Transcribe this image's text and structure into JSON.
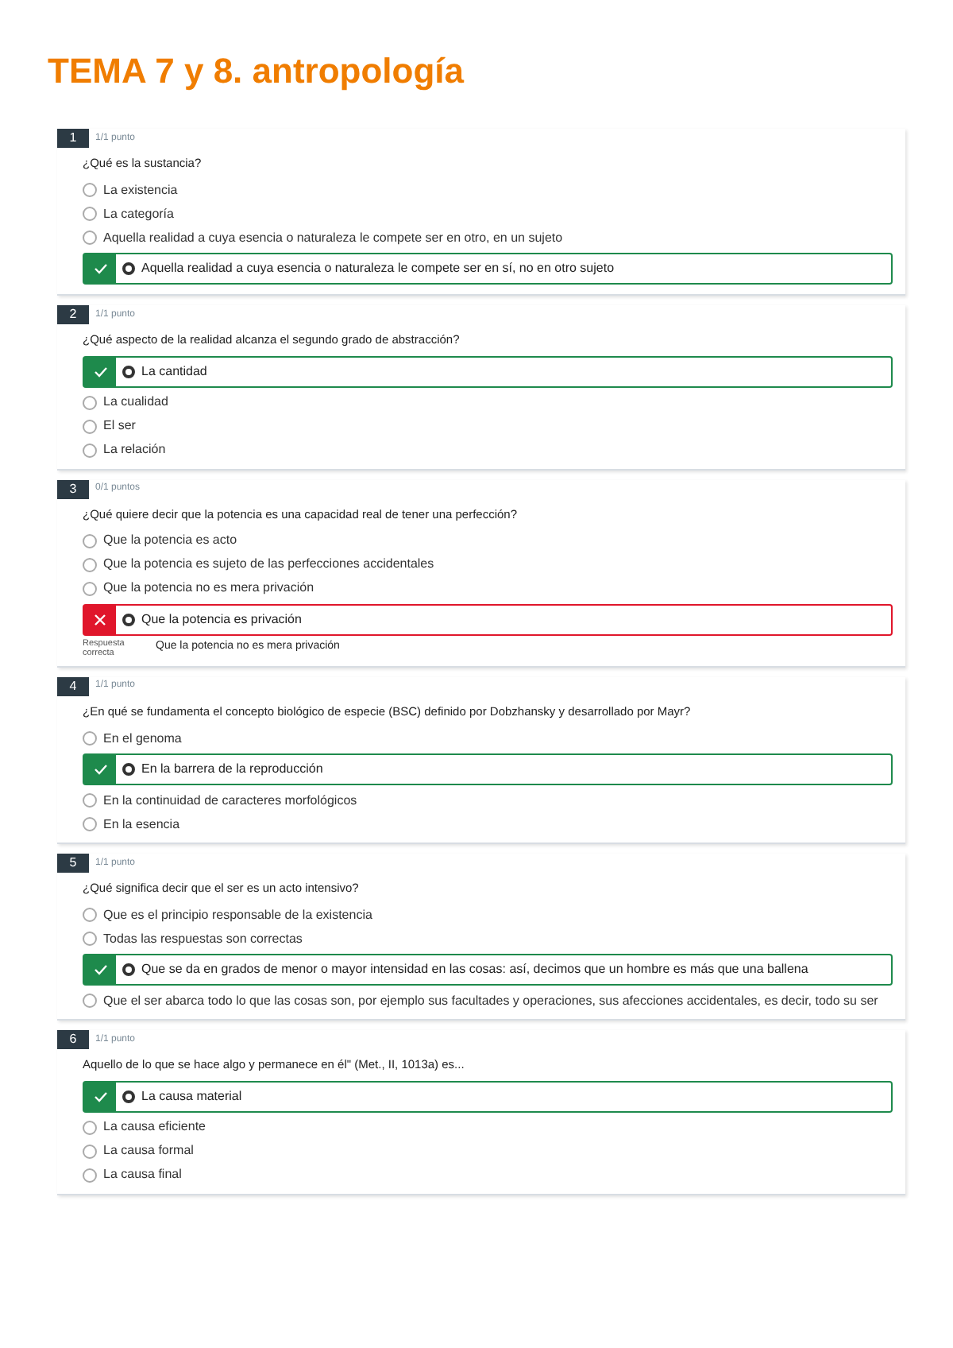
{
  "title": "TEMA 7 y 8. antropología",
  "questions": [
    {
      "number": "1",
      "points": "1/1 punto",
      "text": "¿Qué es la sustancia?",
      "correct": true,
      "options": [
        {
          "text": "La existencia",
          "selected": false
        },
        {
          "text": "La categoría",
          "selected": false
        },
        {
          "text": "Aquella realidad a cuya esencia o naturaleza le compete ser en otro, en un sujeto",
          "selected": false
        },
        {
          "text": "Aquella realidad a cuya esencia o naturaleza le compete ser en sí, no en otro sujeto",
          "selected": true
        }
      ]
    },
    {
      "number": "2",
      "points": "1/1 punto",
      "text": "¿Qué aspecto de la realidad alcanza el segundo grado de abstracción?",
      "correct": true,
      "options": [
        {
          "text": "La cantidad",
          "selected": true
        },
        {
          "text": "La cualidad",
          "selected": false
        },
        {
          "text": "El ser",
          "selected": false
        },
        {
          "text": "La relación",
          "selected": false
        }
      ]
    },
    {
      "number": "3",
      "points": "0/1 puntos",
      "text": "¿Qué quiere decir que la potencia es una capacidad real de tener una perfección?",
      "correct": false,
      "options": [
        {
          "text": "Que la potencia es acto",
          "selected": false
        },
        {
          "text": "Que la potencia es sujeto de las perfecciones accidentales",
          "selected": false
        },
        {
          "text": "Que la potencia no es mera privación",
          "selected": false
        },
        {
          "text": "Que la potencia es privación",
          "selected": true
        }
      ],
      "feedback": {
        "label": "Respuesta correcta",
        "answer": "Que la potencia no es mera privación"
      }
    },
    {
      "number": "4",
      "points": "1/1 punto",
      "text": "¿En qué se fundamenta el concepto biológico de especie (BSC) definido por Dobzhansky y desarrollado por Mayr?",
      "correct": true,
      "options": [
        {
          "text": "En el genoma",
          "selected": false
        },
        {
          "text": "En la barrera de la reproducción",
          "selected": true
        },
        {
          "text": "En la continuidad de caracteres morfológicos",
          "selected": false
        },
        {
          "text": "En la esencia",
          "selected": false
        }
      ]
    },
    {
      "number": "5",
      "points": "1/1 punto",
      "text": "¿Qué significa decir que el ser es un acto intensivo?",
      "correct": true,
      "options": [
        {
          "text": "Que es el principio responsable de la existencia",
          "selected": false
        },
        {
          "text": "Todas las respuestas son correctas",
          "selected": false
        },
        {
          "text": "Que se da en grados de menor o mayor intensidad en las cosas: así, decimos que un hombre es más que una ballena",
          "selected": true
        },
        {
          "text": "Que el ser abarca todo lo que las cosas son, por ejemplo sus facultades y operaciones, sus afecciones accidentales, es decir, todo su ser",
          "selected": false
        }
      ]
    },
    {
      "number": "6",
      "points": "1/1 punto",
      "text": "Aquello de lo que se hace algo y permanece en él\" (Met., II, 1013a) es...",
      "correct": true,
      "options": [
        {
          "text": "La causa material",
          "selected": true
        },
        {
          "text": "La causa eficiente",
          "selected": false
        },
        {
          "text": "La causa formal",
          "selected": false
        },
        {
          "text": "La causa final",
          "selected": false
        }
      ]
    }
  ]
}
